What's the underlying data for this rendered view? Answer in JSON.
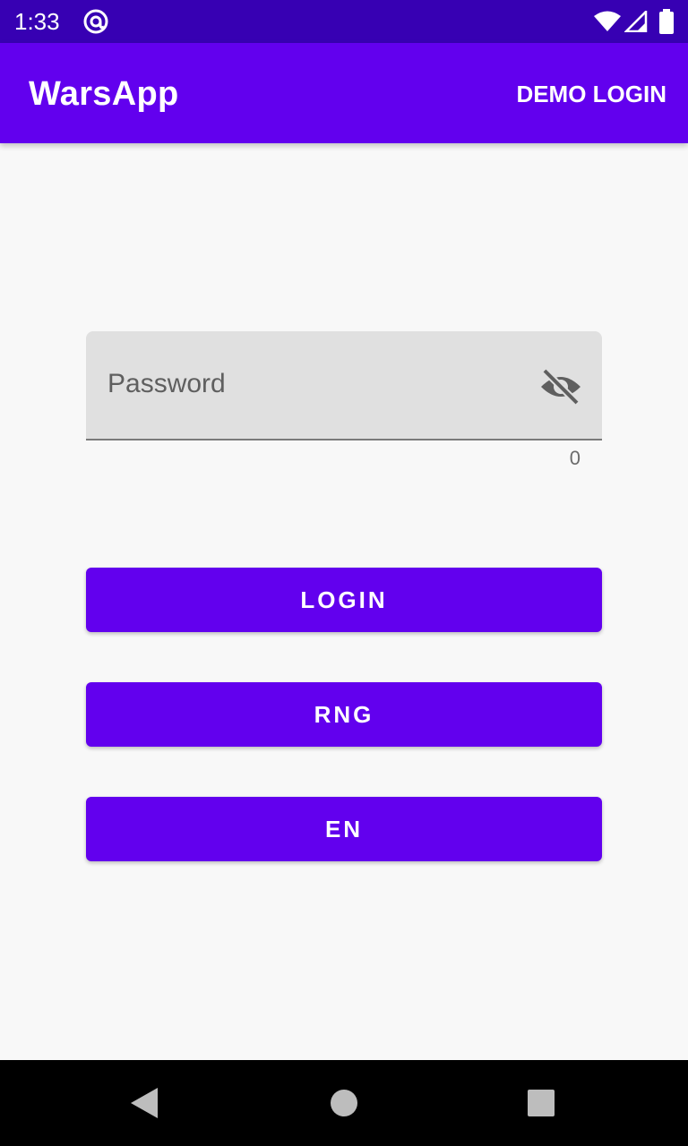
{
  "status_bar": {
    "time": "1:33",
    "icons": [
      "at-sign-icon",
      "wifi-icon",
      "cell-signal-icon",
      "battery-icon"
    ]
  },
  "app_bar": {
    "title": "WarsApp",
    "action_label": "DEMO LOGIN"
  },
  "password_field": {
    "placeholder": "Password",
    "value": "",
    "toggle_icon": "visibility-off-icon",
    "counter": "0"
  },
  "buttons": {
    "login": "LOGIN",
    "rng": "RNG",
    "language": "EN"
  },
  "nav_bar": {
    "icons": [
      "back-icon",
      "home-icon",
      "recents-icon"
    ]
  },
  "colors": {
    "status_bar": "#3700b3",
    "primary": "#6200ee",
    "background": "#f8f8f8",
    "field_fill": "#e0e0e0"
  }
}
